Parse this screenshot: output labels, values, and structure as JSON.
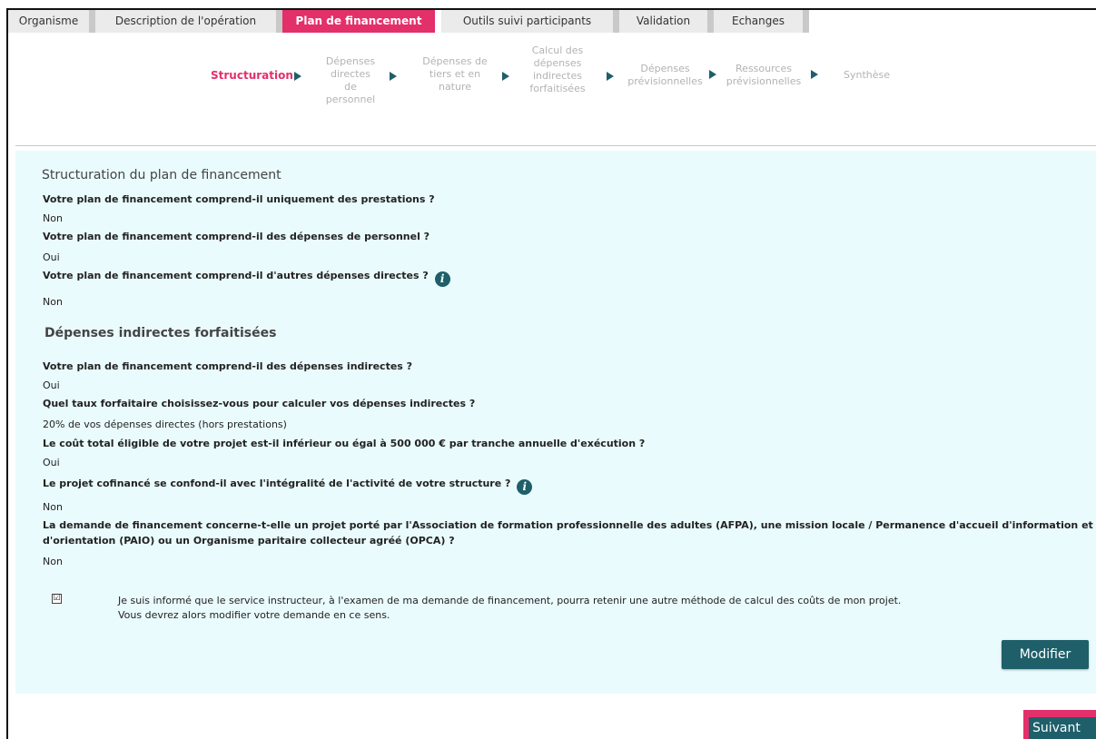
{
  "tabs": [
    {
      "label": "Organisme"
    },
    {
      "label": "Description de l'opération"
    },
    {
      "label": "Plan de financement"
    },
    {
      "label": "Outils suivi participants"
    },
    {
      "label": "Validation"
    },
    {
      "label": "Echanges"
    }
  ],
  "active_tab": "Plan de financement",
  "stepper": {
    "steps": [
      {
        "label": "Structuration",
        "active": true
      },
      {
        "line1": "Dépenses",
        "line2": "directes de",
        "line3": "personnel"
      },
      {
        "line1": "Dépenses de",
        "line2": "tiers et en",
        "line3": "nature"
      },
      {
        "line1": "Calcul des",
        "line2": "dépenses",
        "line3": "indirectes",
        "line4": "forfaitisées"
      },
      {
        "line1": "Dépenses",
        "line2": "prévisionnelles"
      },
      {
        "line1": "Ressources",
        "line2": "prévisionnelles"
      },
      {
        "label": "Synthèse"
      }
    ]
  },
  "section1": {
    "title": "Structuration du plan de financement",
    "items": [
      {
        "question": "Votre plan de financement comprend-il uniquement des prestations ?",
        "answer": "Non"
      },
      {
        "question": "Votre plan de financement comprend-il des dépenses de personnel ?",
        "answer": "Oui"
      },
      {
        "question": "Votre plan de financement comprend-il d'autres dépenses directes ?",
        "answer": "Non",
        "info": true
      }
    ]
  },
  "section2": {
    "title": "Dépenses indirectes forfaitisées",
    "items": [
      {
        "question": "Votre plan de financement comprend-il des dépenses indirectes ?",
        "answer": "Oui"
      },
      {
        "question": "Quel taux forfaitaire choisissez-vous pour calculer vos dépenses indirectes ?",
        "answer": "20% de vos dépenses directes (hors prestations)"
      },
      {
        "question": "Le coût total éligible de votre projet est-il inférieur ou égal à 500 000 € par tranche annuelle d'exécution ?",
        "answer": "Oui"
      },
      {
        "question": "Le projet cofinancé se confond-il avec l'intégralité de l'activité de votre structure ?",
        "answer": "Non",
        "info": true
      },
      {
        "question_line1": "La demande de financement concerne-t-elle un projet porté par l'Association de formation professionnelle des adultes (AFPA), une mission locale / Permanence d'accueil d'information et",
        "question_line2": "d'orientation (PAIO) ou un Organisme paritaire collecteur agréé (OPCA) ?",
        "answer": "Non"
      }
    ]
  },
  "acknowledgement": {
    "checked": true,
    "check_glyph": "☑",
    "line1": "Je suis informé que le service instructeur, à l'examen de ma demande de financement, pourra retenir une autre méthode de calcul des coûts de mon projet.",
    "line2": "Vous devrez alors modifier votre demande en ce sens."
  },
  "buttons": {
    "modifier": "Modifier",
    "suivant": "Suivant"
  },
  "info_glyph": "i",
  "colors": {
    "accent": "#e3306a",
    "primary": "#1e5f6a",
    "panel_bg": "#eafbfd"
  },
  "icons": {
    "info": "info-circle-icon",
    "step_arrow": "triangle-right-icon",
    "checkbox": "checkbox-checked-icon"
  }
}
